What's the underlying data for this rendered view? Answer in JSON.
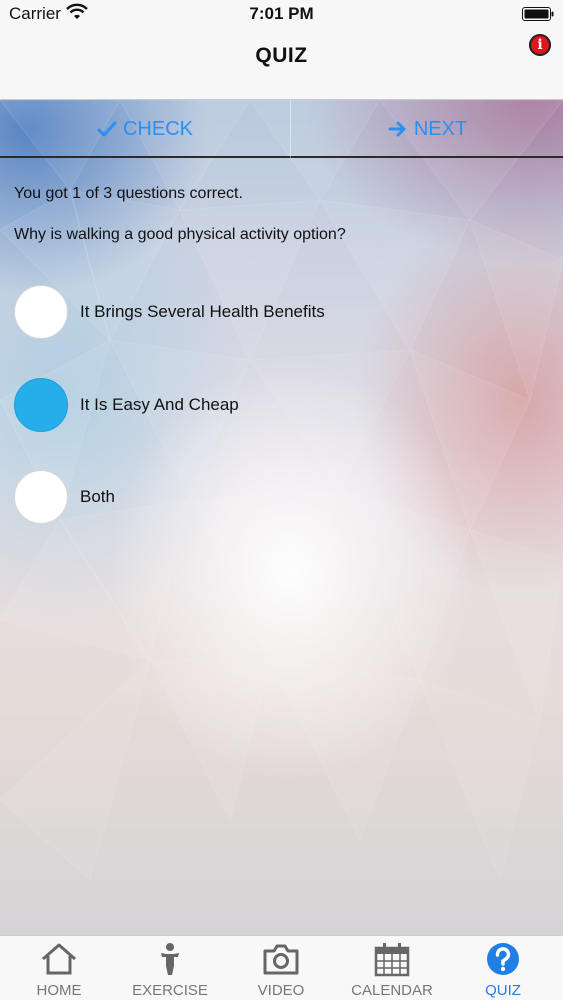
{
  "status_bar": {
    "carrier": "Carrier",
    "time": "7:01 PM"
  },
  "nav": {
    "title": "QUIZ",
    "info_icon": "info-icon",
    "info_color": "#e0141a"
  },
  "actions": {
    "check_label": "CHECK",
    "next_label": "NEXT",
    "accent_color": "#2b8ff2"
  },
  "quiz": {
    "score_text": "You got 1 of 3 questions correct.",
    "question_text": "Why is walking a good physical activity option?",
    "options": [
      {
        "label": "It Brings Several Health Benefits",
        "selected": false
      },
      {
        "label": "It Is Easy And Cheap",
        "selected": true
      },
      {
        "label": "Both",
        "selected": false
      }
    ],
    "selected_color": "#25aee9"
  },
  "tab_bar": {
    "active_color": "#1f7fe5",
    "tabs": [
      {
        "label": "HOME",
        "icon": "home-icon",
        "active": false
      },
      {
        "label": "EXERCISE",
        "icon": "person-icon",
        "active": false
      },
      {
        "label": "VIDEO",
        "icon": "camera-icon",
        "active": false
      },
      {
        "label": "CALENDAR",
        "icon": "calendar-icon",
        "active": false
      },
      {
        "label": "QUIZ",
        "icon": "question-icon",
        "active": true
      }
    ]
  }
}
